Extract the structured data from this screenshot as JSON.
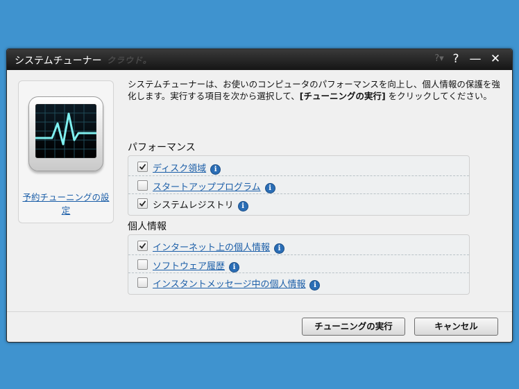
{
  "window": {
    "title": "システムチューナー",
    "ghost_text": "クラウド。",
    "help_menu_label": "?▾",
    "help_label": "?",
    "minimize_label": "—",
    "close_label": "✕"
  },
  "left_panel": {
    "icon": "activity-monitor-icon",
    "schedule_link": "予約チューニングの設定"
  },
  "description": {
    "before": "システムチューナーは、お使いのコンピュータのパフォーマンスを向上し、個人情報の保護を強化します。実行する項目を次から選択して、",
    "bold": "[チューニングの実行]",
    "after": " をクリックしてください。"
  },
  "performance": {
    "title": "パフォーマンス",
    "items": [
      {
        "label": "ディスク領域",
        "checked": true,
        "link": true
      },
      {
        "label": "スタートアッププログラム",
        "checked": false,
        "link": true
      },
      {
        "label": "システムレジストリ",
        "checked": true,
        "link": false
      }
    ]
  },
  "privacy": {
    "title": "個人情報",
    "items": [
      {
        "label": "インターネット上の個人情報",
        "checked": true,
        "link": true
      },
      {
        "label": "ソフトウェア履歴",
        "checked": false,
        "link": true
      },
      {
        "label": "インスタントメッセージ中の個人情報",
        "checked": false,
        "link": true
      }
    ]
  },
  "info_symbol": "i",
  "buttons": {
    "run": "チューニングの実行",
    "cancel": "キャンセル"
  },
  "colors": {
    "background": "#3f93cf",
    "titlebar": "#1e1e1e",
    "link": "#1b5ea8",
    "info_icon": "#2a6db5"
  }
}
